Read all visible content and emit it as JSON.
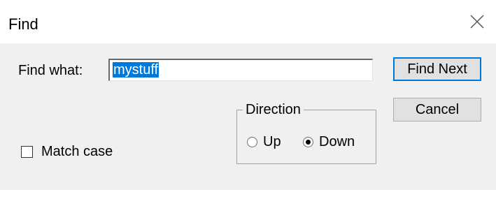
{
  "window": {
    "title": "Find"
  },
  "find": {
    "label": "Find what:",
    "value": "mystuff"
  },
  "buttons": {
    "find_next": "Find Next",
    "cancel": "Cancel"
  },
  "direction": {
    "title": "Direction",
    "options": [
      {
        "label": "Up",
        "selected": false
      },
      {
        "label": "Down",
        "selected": true
      }
    ]
  },
  "match_case": {
    "label": "Match case",
    "checked": false
  },
  "colors": {
    "selection": "#0078d7",
    "dialog_bg": "#f0f0f0"
  }
}
